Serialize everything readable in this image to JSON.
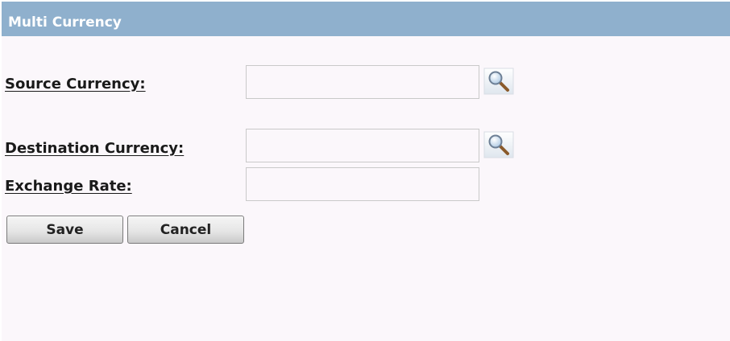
{
  "header": {
    "title": "Multi Currency"
  },
  "form": {
    "source_currency": {
      "label": "Source Currency:",
      "value": "",
      "lookup_icon": "search-icon"
    },
    "destination_currency": {
      "label": "Destination Currency:",
      "value": "",
      "lookup_icon": "search-icon"
    },
    "exchange_rate": {
      "label": "Exchange Rate:",
      "value": ""
    }
  },
  "buttons": {
    "save_label": "Save",
    "cancel_label": "Cancel"
  },
  "colors": {
    "header_bar": "#8fb0cd",
    "panel_background": "#fbf7fb"
  }
}
